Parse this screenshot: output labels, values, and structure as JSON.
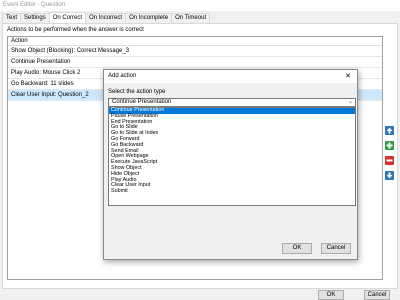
{
  "window": {
    "title": "Event Editor - Question"
  },
  "tabs": [
    "Text",
    "Settings",
    "On Correct",
    "On Incorrect",
    "On Incomplete",
    "On Timeout"
  ],
  "active_tab": 2,
  "panel": {
    "section_label": "Actions to be performed when the answer is correct",
    "column_header": "Action",
    "rows": [
      "Show Object (Blocking): Correct Message_3",
      "Continue Presentation",
      "Play Audio: Mouse Click 2",
      "Go Backward: 11 slides",
      "Clear User Input: Question_2"
    ],
    "selected_row": 4
  },
  "side_buttons": {
    "up_color": "#2e75b6",
    "add_color": "#2ea043",
    "remove_color": "#d9312a",
    "down_color": "#2e75b6"
  },
  "footer": {
    "ok_label": "OK",
    "cancel_label": "Cancel"
  },
  "dialog": {
    "title": "Add action",
    "close_glyph": "✕",
    "label": "Select the action type",
    "selected_value": "Continue Presentation",
    "options": [
      "Continue Presentation",
      "Pause Presentation",
      "End Presentation",
      "Go to Slide",
      "Go to Slide at Index",
      "Go Forward",
      "Go Backward",
      "Send Email",
      "Open Webpage",
      "Execute JavaScript",
      "Show Object",
      "Hide Object",
      "Play Audio",
      "Clear User Input",
      "Submit"
    ],
    "selected_option": 0,
    "ok_label": "OK",
    "cancel_label": "Cancel"
  }
}
